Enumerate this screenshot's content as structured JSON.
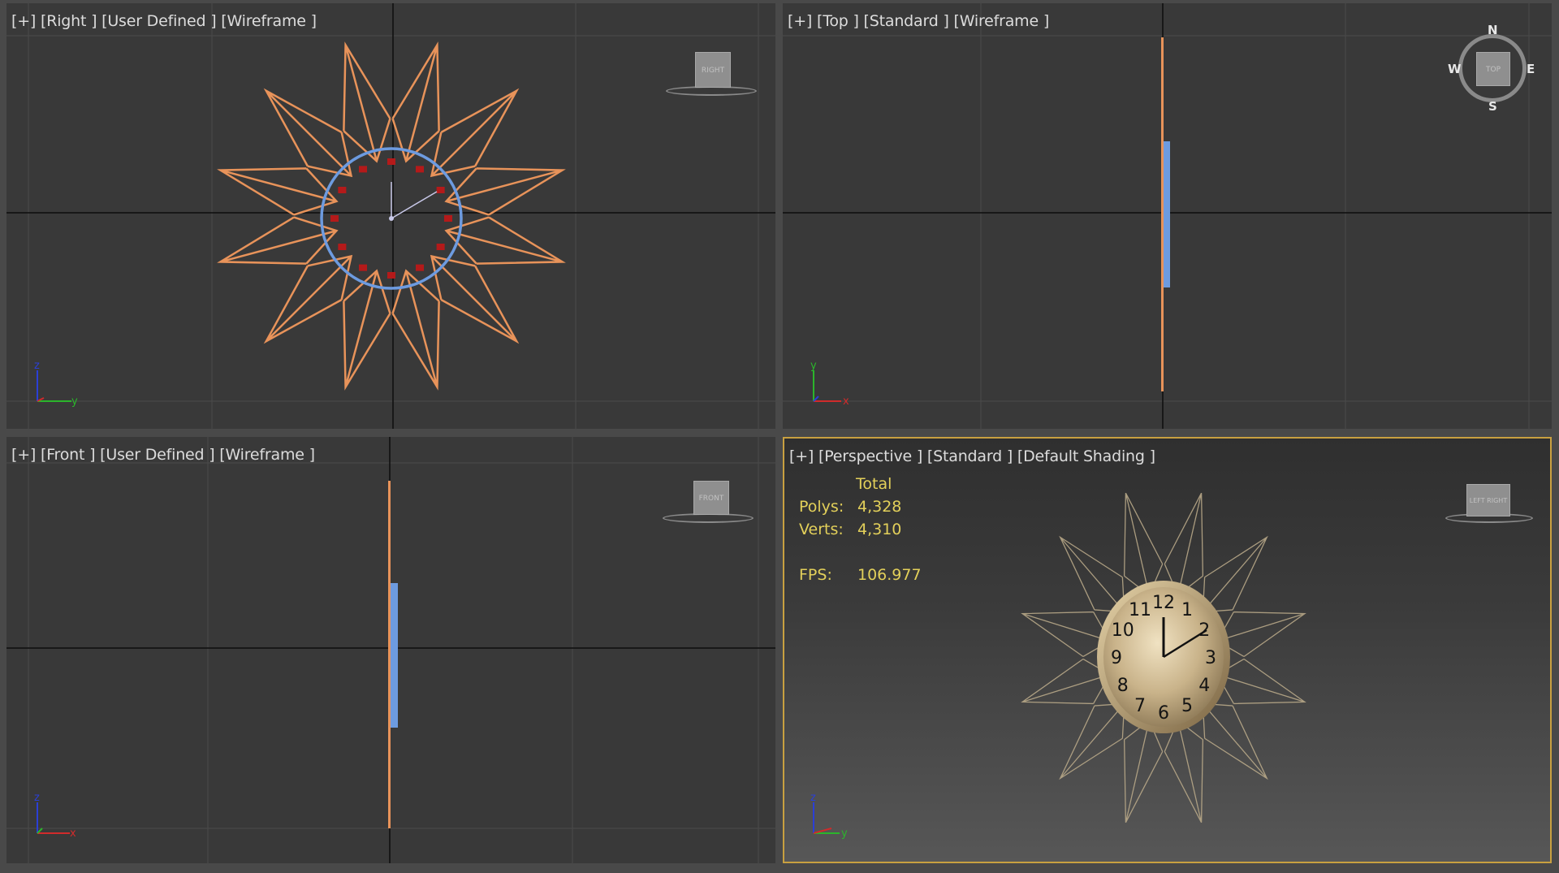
{
  "viewports": {
    "top_left": {
      "label": "[+] [Right ] [User Defined ] [Wireframe ]",
      "cube_label": "RIGHT",
      "axes": [
        "z",
        "y"
      ]
    },
    "top_right": {
      "label": "[+] [Top ] [Standard ] [Wireframe ]",
      "cube_label": "TOP",
      "axes": [
        "y",
        "x"
      ],
      "compass": {
        "n": "N",
        "s": "S",
        "e": "E",
        "w": "W"
      }
    },
    "bottom_left": {
      "label": "[+] [Front ] [User Defined ] [Wireframe ]",
      "cube_label": "FRONT",
      "axes": [
        "z",
        "x"
      ]
    },
    "bottom_right": {
      "label": "[+] [Perspective ] [Standard ] [Default Shading ]",
      "cube_label": "LEFT  RIGHT",
      "axes": [
        "z",
        "y"
      ],
      "stats": {
        "header": "Total",
        "polys_label": "Polys:",
        "polys_value": "4,328",
        "verts_label": "Verts:",
        "verts_value": "4,310",
        "fps_label": "FPS:",
        "fps_value": "106.977"
      }
    }
  },
  "clock_numerals": [
    "12",
    "1",
    "2",
    "3",
    "4",
    "5",
    "6",
    "7",
    "8",
    "9",
    "10",
    "11"
  ],
  "colors": {
    "wire_orange": "#e8935a",
    "wire_blue": "#6d9be0",
    "active_border": "#c8a040",
    "stats_yellow": "#e3d05a",
    "grid": "#4a4a4a",
    "axis": "#0d0d0d"
  }
}
